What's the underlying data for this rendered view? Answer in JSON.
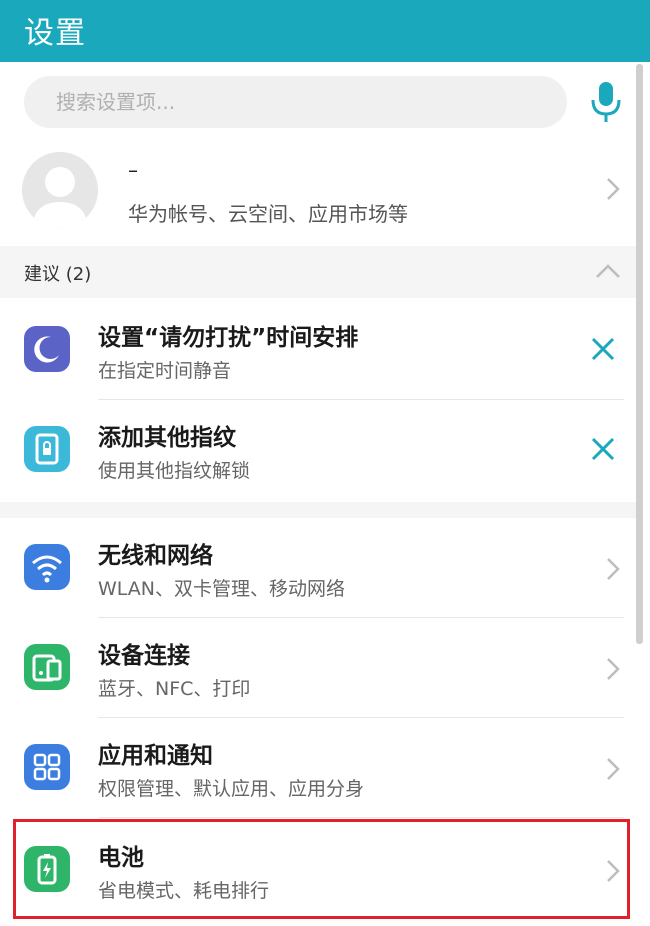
{
  "header": {
    "title": "设置"
  },
  "search": {
    "placeholder": "搜索设置项..."
  },
  "account": {
    "name": "–",
    "subtitle": "华为帐号、云空间、应用市场等"
  },
  "suggestions": {
    "header": "建议 (2)",
    "items": [
      {
        "title": "设置“请勿打扰”时间安排",
        "subtitle": "在指定时间静音",
        "icon": "moon-icon",
        "color": "#5b63c7"
      },
      {
        "title": "添加其他指纹",
        "subtitle": "使用其他指纹解锁",
        "icon": "fingerprint-lock-icon",
        "color": "#3cb8d8"
      }
    ]
  },
  "settings": {
    "items": [
      {
        "title": "无线和网络",
        "subtitle": "WLAN、双卡管理、移动网络",
        "icon": "wifi-icon",
        "color": "#3c7de0"
      },
      {
        "title": "设备连接",
        "subtitle": "蓝牙、NFC、打印",
        "icon": "device-connection-icon",
        "color": "#2fb56a"
      },
      {
        "title": "应用和通知",
        "subtitle": "权限管理、默认应用、应用分身",
        "icon": "apps-grid-icon",
        "color": "#3c7de0"
      },
      {
        "title": "电池",
        "subtitle": "省电模式、耗电排行",
        "icon": "battery-icon",
        "color": "#2fb56a"
      }
    ]
  },
  "colors": {
    "header": "#1aa8bd",
    "accent": "#1aa8bd",
    "highlight": "#e0202a"
  }
}
